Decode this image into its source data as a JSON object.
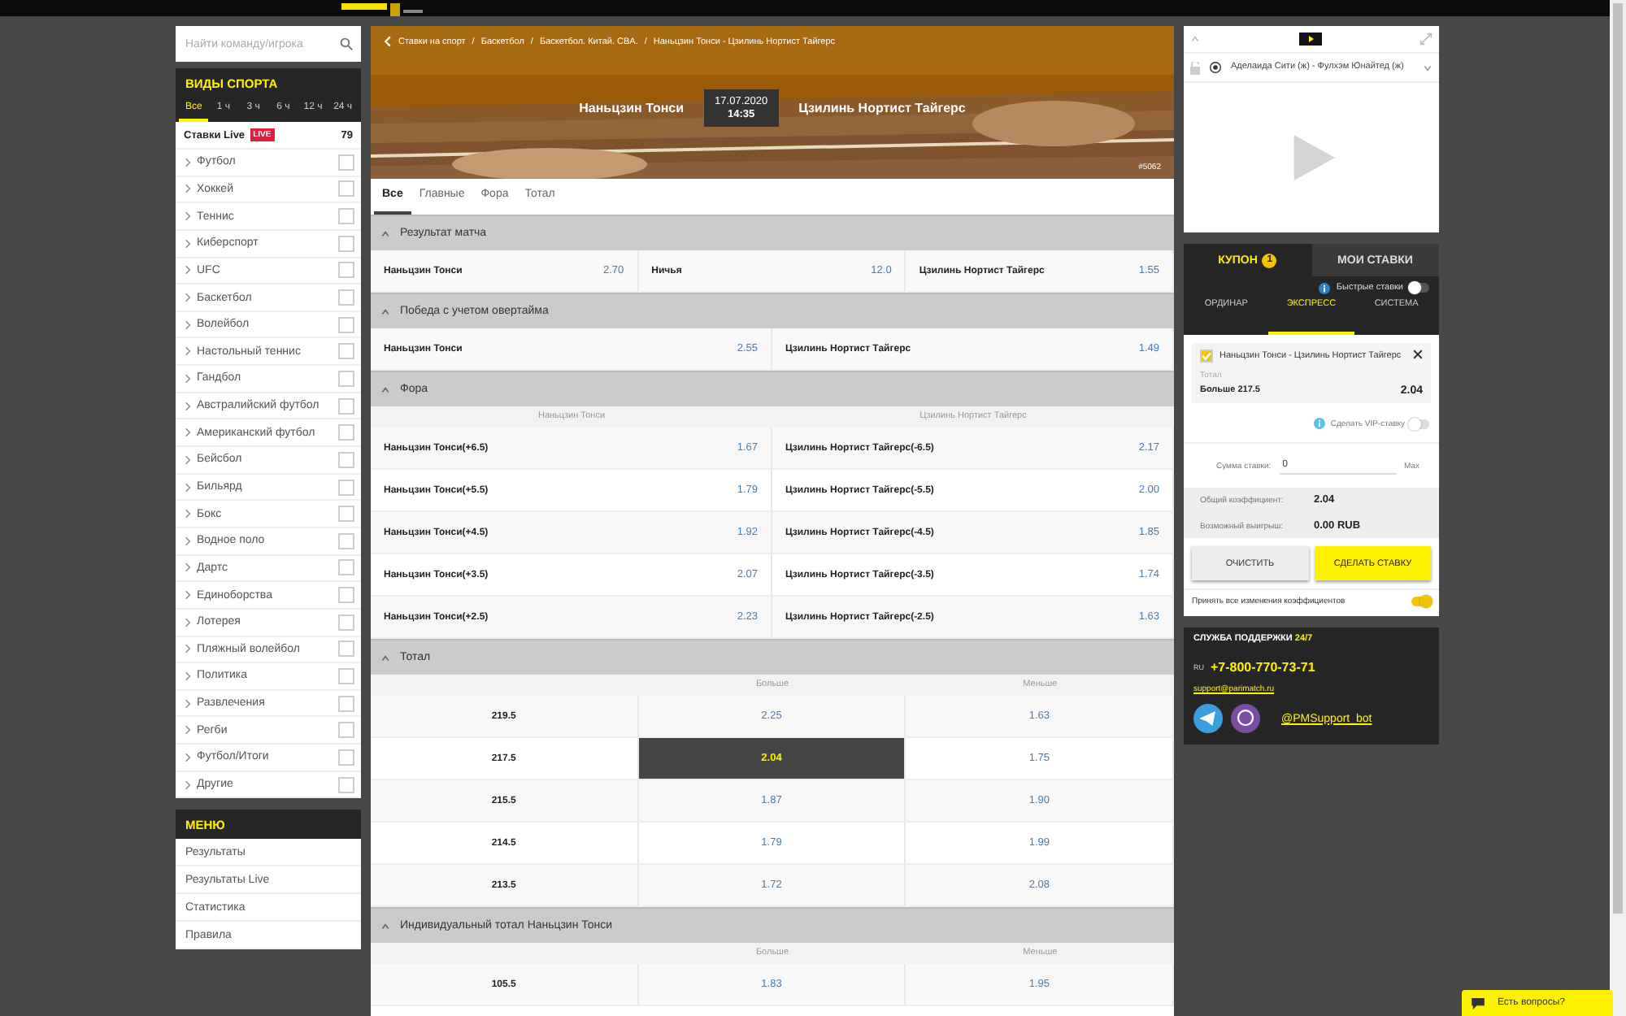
{
  "search": {
    "placeholder": "Найти команду/игрока"
  },
  "sports": {
    "title": "ВИДЫ СПОРТА",
    "time_filters": [
      {
        "label": "Все",
        "selected": true
      },
      {
        "label": "1 ч",
        "selected": false
      },
      {
        "label": "3 ч",
        "selected": false
      },
      {
        "label": "6 ч",
        "selected": false
      },
      {
        "label": "12 ч",
        "selected": false
      },
      {
        "label": "24 ч",
        "selected": false
      }
    ],
    "live": {
      "label": "Ставки Live",
      "badge": "LIVE",
      "count": "79"
    },
    "items": [
      {
        "label": "Футбол",
        "checked": false
      },
      {
        "label": "Хоккей",
        "checked": false
      },
      {
        "label": "Теннис",
        "checked": false
      },
      {
        "label": "Киберспорт",
        "checked": false
      },
      {
        "label": "UFC",
        "checked": false
      },
      {
        "label": "Баскетбол",
        "checked": false
      },
      {
        "label": "Волейбол",
        "checked": false
      },
      {
        "label": "Настольный теннис",
        "checked": false
      },
      {
        "label": "Гандбол",
        "checked": false
      },
      {
        "label": "Австралийский футбол",
        "checked": false
      },
      {
        "label": "Американский футбол",
        "checked": false
      },
      {
        "label": "Бейсбол",
        "checked": false
      },
      {
        "label": "Бильярд",
        "checked": false
      },
      {
        "label": "Бокс",
        "checked": false
      },
      {
        "label": "Водное поло",
        "checked": false
      },
      {
        "label": "Дартс",
        "checked": false
      },
      {
        "label": "Единоборства",
        "checked": false
      },
      {
        "label": "Лотерея",
        "checked": false
      },
      {
        "label": "Пляжный волейбол",
        "checked": false
      },
      {
        "label": "Политика",
        "checked": false
      },
      {
        "label": "Развлечения",
        "checked": false
      },
      {
        "label": "Регби",
        "checked": false
      },
      {
        "label": "Футбол/Итоги",
        "checked": false
      },
      {
        "label": "Другие",
        "checked": false
      }
    ]
  },
  "menu": {
    "title": "МЕНЮ",
    "items": [
      "Результаты",
      "Результаты Live",
      "Статистика",
      "Правила"
    ]
  },
  "event": {
    "separators": [
      "/",
      "/",
      "/"
    ],
    "breadcrumbs": [
      "Ставки на спорт",
      "Баскетбол",
      "Баскетбол. Китай. CBA.",
      "Наньцзин Тонси - Цзилинь Нортист Тайгерс"
    ],
    "home": "Наньцзин Тонси",
    "date": "17.07.2020",
    "time": "14:35",
    "away": "Цзилинь Нортист Тайгерс",
    "id": "#5062"
  },
  "market_tabs": [
    {
      "label": "Все",
      "selected": true
    },
    {
      "label": "Главные",
      "selected": false
    },
    {
      "label": "Фора",
      "selected": false
    },
    {
      "label": "Тотал",
      "selected": false
    }
  ],
  "markets": [
    {
      "kind": "outcomes",
      "title": "Результат матча",
      "expanded": true,
      "rows": [
        {
          "cells": [
            {
              "label": "Наньцзин Тонси",
              "odds": "2.70",
              "selected": false
            },
            {
              "label": "Ничья",
              "odds": "12.0",
              "selected": false
            },
            {
              "label": "Цзилинь Нортист Тайгерс",
              "odds": "1.55",
              "selected": false
            }
          ]
        }
      ]
    },
    {
      "kind": "outcomes",
      "title": "Победа с учетом овертайма",
      "expanded": true,
      "rows": [
        {
          "cells": [
            {
              "label": "Наньцзин Тонси",
              "odds": "2.55",
              "selected": false
            },
            {
              "label": "Цзилинь Нортист Тайгерс",
              "odds": "1.49",
              "selected": false
            }
          ]
        }
      ]
    },
    {
      "kind": "outcomes",
      "title": "Фора",
      "expanded": true,
      "columns": [
        "Наньцзин Тонси",
        "Цзилинь Нортист Тайгерс"
      ],
      "rows": [
        {
          "cells": [
            {
              "label": "Наньцзин Тонси(+6.5)",
              "odds": "1.67",
              "selected": false
            },
            {
              "label": "Цзилинь Нортист Тайгерс(-6.5)",
              "odds": "2.17",
              "selected": false
            }
          ]
        },
        {
          "cells": [
            {
              "label": "Наньцзин Тонси(+5.5)",
              "odds": "1.79",
              "selected": false
            },
            {
              "label": "Цзилинь Нортист Тайгерс(-5.5)",
              "odds": "2.00",
              "selected": false
            }
          ]
        },
        {
          "cells": [
            {
              "label": "Наньцзин Тонси(+4.5)",
              "odds": "1.92",
              "selected": false
            },
            {
              "label": "Цзилинь Нортист Тайгерс(-4.5)",
              "odds": "1.85",
              "selected": false
            }
          ]
        },
        {
          "cells": [
            {
              "label": "Наньцзин Тонси(+3.5)",
              "odds": "2.07",
              "selected": false
            },
            {
              "label": "Цзилинь Нортист Тайгерс(-3.5)",
              "odds": "1.74",
              "selected": false
            }
          ]
        },
        {
          "cells": [
            {
              "label": "Наньцзин Тонси(+2.5)",
              "odds": "2.23",
              "selected": false
            },
            {
              "label": "Цзилинь Нортист Тайгерс(-2.5)",
              "odds": "1.63",
              "selected": false
            }
          ]
        }
      ]
    },
    {
      "kind": "totals",
      "title": "Тотал",
      "expanded": true,
      "columns": [
        "Больше",
        "Меньше"
      ],
      "rows": [
        {
          "line": "219.5",
          "cells": [
            {
              "odds": "2.25",
              "selected": false
            },
            {
              "odds": "1.63",
              "selected": false
            }
          ]
        },
        {
          "line": "217.5",
          "cells": [
            {
              "odds": "2.04",
              "selected": true
            },
            {
              "odds": "1.75",
              "selected": false
            }
          ]
        },
        {
          "line": "215.5",
          "cells": [
            {
              "odds": "1.87",
              "selected": false
            },
            {
              "odds": "1.90",
              "selected": false
            }
          ]
        },
        {
          "line": "214.5",
          "cells": [
            {
              "odds": "1.79",
              "selected": false
            },
            {
              "odds": "1.99",
              "selected": false
            }
          ]
        },
        {
          "line": "213.5",
          "cells": [
            {
              "odds": "1.72",
              "selected": false
            },
            {
              "odds": "2.08",
              "selected": false
            }
          ]
        }
      ]
    },
    {
      "kind": "totals",
      "title": "Индивидуальный тотал Наньцзин Тонси",
      "expanded": true,
      "columns": [
        "Больше",
        "Меньше"
      ],
      "rows": [
        {
          "line": "105.5",
          "cells": [
            {
              "odds": "1.83",
              "selected": false
            },
            {
              "odds": "1.95",
              "selected": false
            }
          ]
        }
      ]
    }
  ],
  "video": {
    "match": "Аделаида Сити (ж) - Фулхэм Юнайтед (ж)"
  },
  "coupon": {
    "tabs": [
      {
        "label": "КУПОН",
        "badge": "1",
        "selected": true
      },
      {
        "label": "МОИ СТАВКИ",
        "selected": false
      }
    ],
    "quick_bets": {
      "label": "Быстрые ставки",
      "on": false
    },
    "types": [
      {
        "label": "ОРДИНАР",
        "selected": false
      },
      {
        "label": "ЭКСПРЕСС",
        "selected": true
      },
      {
        "label": "СИСТЕМА",
        "selected": false
      }
    ],
    "bet": {
      "checked": true,
      "event": "Наньцзин Тонси - Цзилинь Нортист Тайгерс",
      "market": "Тотал",
      "pick": "Больше 217.5",
      "odds": "2.04"
    },
    "vip": {
      "label": "Сделать VIP-ставку",
      "on": false
    },
    "stake": {
      "label": "Сумма ставки:",
      "value": "0",
      "max": "Max"
    },
    "total_odds": {
      "label": "Общий коэффициент:",
      "value": "2.04"
    },
    "payout": {
      "label": "Возможный выигрыш:",
      "value": "0.00 RUB"
    },
    "buttons": [
      {
        "kind": "clear",
        "label": "ОЧИСТИТЬ"
      },
      {
        "kind": "place",
        "label": "СДЕЛАТЬ СТАВКУ"
      }
    ],
    "accept_changes": {
      "label": "Принять все изменения коэффициентов",
      "on": true
    }
  },
  "support": {
    "title": "СЛУЖБА ПОДДЕРЖКИ",
    "hours": "24/7",
    "locale": "RU",
    "phone": "+7-800-770-73-71",
    "email": "support@parimatch.ru",
    "bot": "@PMSupport_bot"
  },
  "chat": {
    "label": "Есть вопросы?"
  }
}
